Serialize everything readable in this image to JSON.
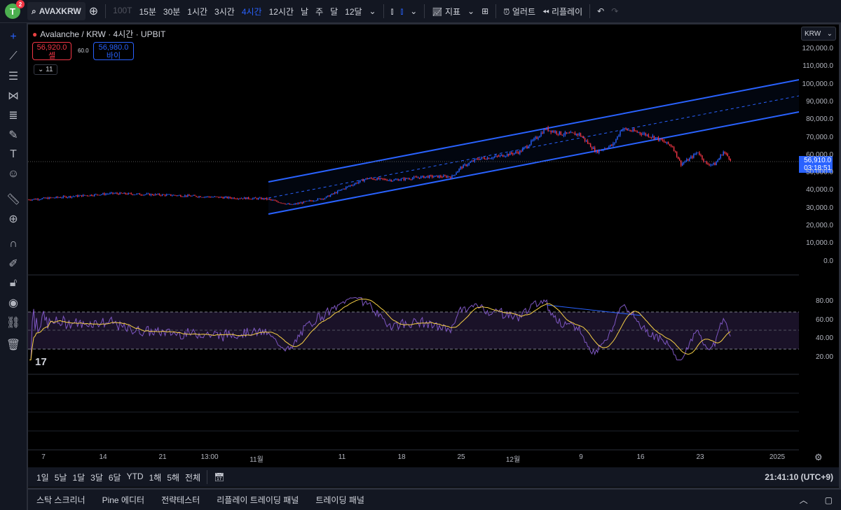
{
  "toolbar": {
    "avatar": "T",
    "badge": "2",
    "symbol": "AVAXKRW",
    "intervals": [
      {
        "label": "100T",
        "state": "dim"
      },
      {
        "label": "15분"
      },
      {
        "label": "30분"
      },
      {
        "label": "1시간"
      },
      {
        "label": "3시간"
      },
      {
        "label": "4시간",
        "state": "act"
      },
      {
        "label": "12시간"
      },
      {
        "label": "날"
      },
      {
        "label": "주"
      },
      {
        "label": "달"
      },
      {
        "label": "12달"
      }
    ],
    "indicators": "지표",
    "alert": "얼러트",
    "replay": "리플레이"
  },
  "legend": {
    "title": "Avalanche / KRW · 4시간 · UPBIT",
    "sell_price": "56,920.0",
    "sell_label": "셀",
    "spread": "60.0",
    "buy_price": "56,980.0",
    "buy_label": "바이",
    "indicator_count": "11"
  },
  "price_axis": {
    "currency": "KRW",
    "labels": [
      "120,000.0",
      "110,000.0",
      "100,000.0",
      "90,000.0",
      "80,000.0",
      "70,000.0",
      "60,000.0",
      "50,000.0",
      "40,000.0",
      "30,000.0",
      "20,000.0",
      "10,000.0",
      "0.0"
    ],
    "last_price": "56,910.0",
    "countdown": "03:18:51",
    "last_color": "#2962ff"
  },
  "rsi_axis": {
    "labels": [
      "80.00",
      "60.00",
      "40.00",
      "20.00"
    ]
  },
  "time_axis": [
    "7",
    "14",
    "21",
    "13:00",
    "11월",
    "11",
    "18",
    "25",
    "12월",
    "9",
    "16",
    "23",
    "2025"
  ],
  "range_bar": {
    "ranges": [
      "1일",
      "5날",
      "1달",
      "3달",
      "6달",
      "YTD",
      "1해",
      "5해",
      "전체"
    ],
    "clock": "21:41:10 (UTC+9)"
  },
  "bottom_tabs": [
    "스탁 스크리너",
    "Pine 에디터",
    "전략테스터",
    "리플레이 트레이딩 패널",
    "트레이딩 패널"
  ],
  "chart_data": {
    "type": "candlestick",
    "unit": "KRW thousand",
    "x_days_from_oct4": [
      0,
      10,
      17,
      24,
      28,
      31,
      35,
      38,
      40,
      43,
      47,
      50,
      51,
      53,
      55,
      58,
      60,
      61,
      63,
      65,
      67,
      69,
      70,
      72,
      74,
      76,
      77,
      78,
      79,
      80,
      81,
      82,
      83
    ],
    "close": [
      35,
      38.5,
      37.5,
      36,
      35.5,
      32,
      36,
      43,
      47,
      46,
      48,
      48,
      53,
      58,
      59,
      62,
      70,
      75,
      72,
      72,
      62,
      66,
      75,
      73,
      70,
      65,
      55,
      58,
      62,
      55,
      55,
      62,
      57
    ],
    "up_color": "#2962ff",
    "down_color": "#f23645"
  }
}
